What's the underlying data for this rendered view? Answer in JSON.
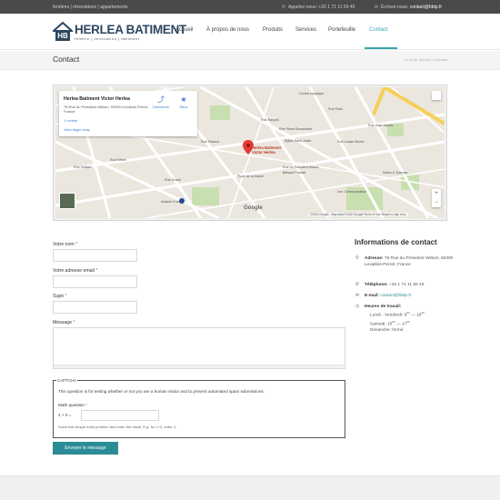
{
  "topbar": {
    "tagline": "fenêtres | rénovations | appartements",
    "phone": "Appelez-nous: +33 1 71 11 59 45",
    "email_prefix": "Écrivez-nous: ",
    "email": "contact@hbtp.fr"
  },
  "logo": {
    "mark": "HB",
    "name": "HERLEA BATIMENT",
    "tagline": "fenêtre | rénovation | bâtiment"
  },
  "nav": [
    {
      "label": "Accueil"
    },
    {
      "label": "À propos de nous"
    },
    {
      "label": "Produits"
    },
    {
      "label": "Services"
    },
    {
      "label": "Portefeuille"
    },
    {
      "label": "Contact",
      "active": true
    }
  ],
  "page": {
    "title": "Contact",
    "breadcrumb": "Tu es là: Accueil > Contact"
  },
  "map": {
    "place_name": "Herlea Batiment Victor Herlea",
    "address": "76 Rue du Président Wilson, 92300 Levallois-Perret, France",
    "reviews": "1 review",
    "larger_map": "View larger map",
    "directions": "Directions",
    "save": "Save",
    "pin_label_1": "Herlea Batiment",
    "pin_label_2": "Victor Herlea",
    "google": "Google",
    "footer": "©2016 Google - Map data ©2016 Google   Terms of Use   Report a map error",
    "labels": {
      "equipment": "Centre équipique",
      "paris": "Rue Paris",
      "raspail": "Rue Raspail",
      "brossolette": "Rue Pierre Brossolette",
      "wilson": "Rue du Président Wilson",
      "louise": "Rue Louise Michel",
      "eglise": "Église Saint Justin",
      "pasteur": "Rue Pasteur",
      "banque": "Banque Postale",
      "place": "Place de la Marne",
      "marks": "Marks & Spencer",
      "vox": "Vox Communication",
      "anatole": "Anatole France",
      "kleber": "Rue Kléber",
      "voltaire": "Rue Voltaire",
      "jaures": "Rue Jean Jaurès",
      "gravel": "Rue Gravel"
    }
  },
  "form": {
    "name_label": "Votre nom",
    "email_label": "Votre adresse email",
    "subject_label": "Sujet",
    "message_label": "Message",
    "required_mark": "*",
    "captcha_legend": "CAPTCHA",
    "captcha_desc": "This question is for testing whether or not you are a human visitor and to prevent automated spam submissions.",
    "math_label": "Math question",
    "math_eq": "4 + 0 =",
    "math_hint": "Solve this simple math problem and enter the result. E.g. for 1+3, enter 4.",
    "submit": "Envoyer le message"
  },
  "contact": {
    "title": "Informations de contact",
    "address_label": "Adresse:",
    "address": "76 Rue du Président Wilson, 92300 Levallois-Perret, France",
    "phone_label": "Téléphone:",
    "phone": "+33 1 71 11 59 45",
    "email_label": "E-mail:",
    "email": "contact@hbtp.fr",
    "hours_label": "Heures de travail:",
    "hours_weekdays_label": "Lundi - Vendredi:",
    "hours_weekdays_open": "9",
    "hours_weekdays_close": "18",
    "hours_saturday_label": "Samedi:",
    "hours_saturday_open": "10",
    "hours_saturday_close": "17",
    "minutes": "00",
    "range_sep": " — ",
    "hours_sunday": "Dimanche: fermé"
  },
  "colors": {
    "accent": "#2b8c95",
    "nav_active": "#3aa3b0",
    "topbar": "#4a4a4a",
    "logo": "#2c4660",
    "required": "#d9534f"
  }
}
